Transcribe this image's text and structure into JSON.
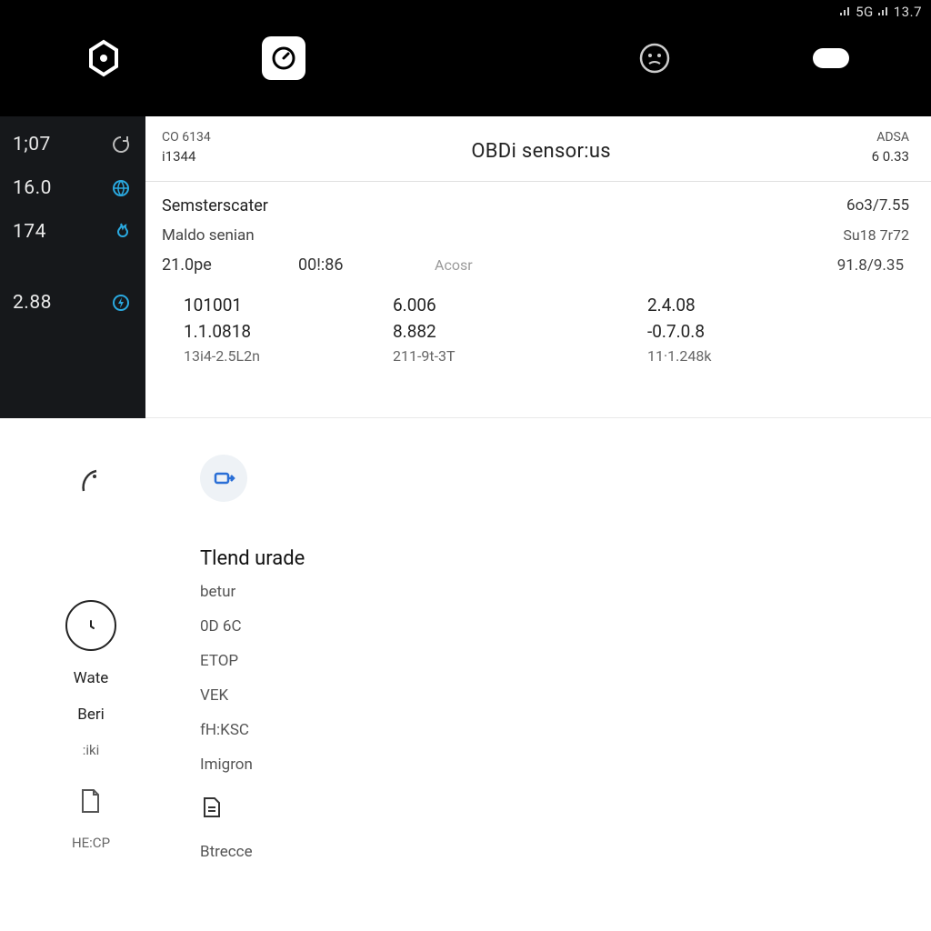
{
  "status": {
    "right": "13.7",
    "sig_label": "5G"
  },
  "sidebar": {
    "rows": [
      {
        "value": "1;07"
      },
      {
        "value": "16.0"
      },
      {
        "value": "174"
      },
      {
        "value": "2.88"
      }
    ]
  },
  "panel": {
    "meta_l1": "CO 6134",
    "meta_l2": "i1344",
    "title": "OBDi sensor:us",
    "right_l1": "ADSA",
    "right_l2": "6 0.33",
    "rows": [
      {
        "left": "Semsterscater",
        "right": "6o3/7.55"
      },
      {
        "left": "Maldo senian",
        "right": "Su18 7r72"
      }
    ],
    "inline": {
      "a": "21.0pe",
      "b": "00!:86",
      "c": "Acosr",
      "right": "91.8/9.35"
    },
    "grid": {
      "r1": [
        "101001",
        "6.006",
        "2.4.08"
      ],
      "r2": [
        "1.1.0818",
        "8.882",
        "-0.7.0.8"
      ],
      "r3": [
        "13i4-2.5L2n",
        "211-9t-3T",
        "11·1.248k"
      ]
    }
  },
  "lower": {
    "left": {
      "label1": "Wate",
      "label2": "Beri",
      "label3": ":iki",
      "label4": "HE:CP"
    },
    "section_title": "Tlend urade",
    "items": [
      "betur",
      "0D 6C",
      "ETOP",
      "VEK",
      "fH:KSC",
      "Imigron",
      "Btrecce"
    ]
  }
}
